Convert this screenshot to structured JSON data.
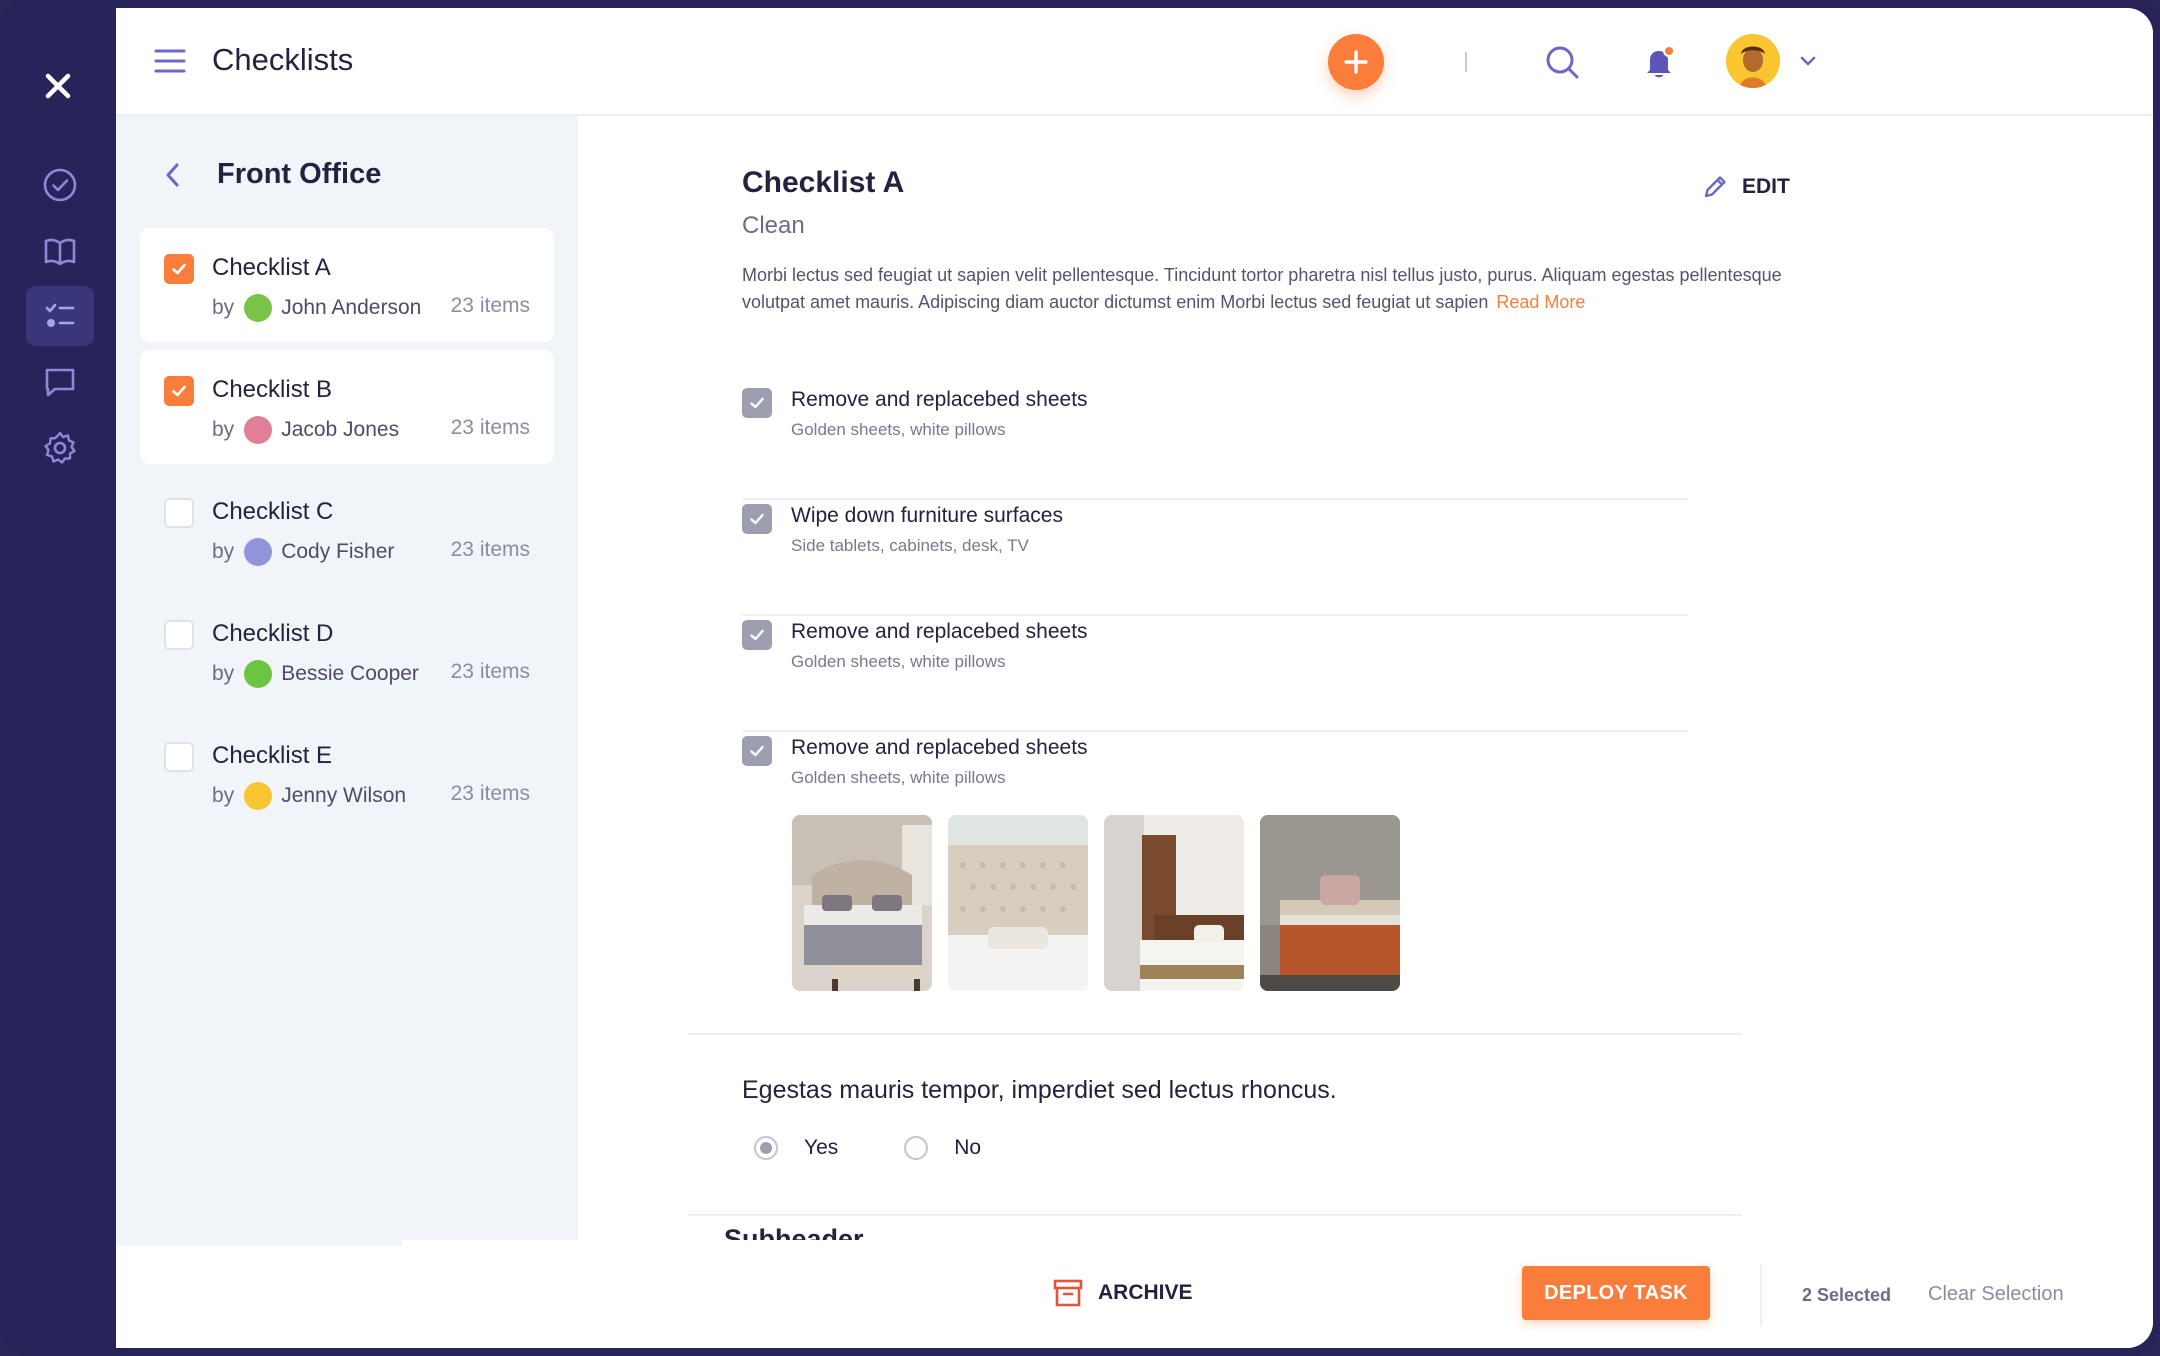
{
  "header": {
    "title": "Checklists"
  },
  "panel": {
    "title": "Front Office"
  },
  "checklists": [
    {
      "title": "Checklist A",
      "by": "by",
      "author": "John Anderson",
      "count": "23 items",
      "checked": true
    },
    {
      "title": "Checklist B",
      "by": "by",
      "author": "Jacob Jones",
      "count": "23 items",
      "checked": true
    },
    {
      "title": "Checklist C",
      "by": "by",
      "author": "Cody Fisher",
      "count": "23 items",
      "checked": false
    },
    {
      "title": "Checklist D",
      "by": "by",
      "author": "Bessie Cooper",
      "count": "23 items",
      "checked": false
    },
    {
      "title": "Checklist E",
      "by": "by",
      "author": "Jenny Wilson",
      "count": "23 items",
      "checked": false
    }
  ],
  "detail": {
    "title": "Checklist A",
    "subtitle": "Clean",
    "edit_label": "EDIT",
    "description": "Morbi lectus sed feugiat ut sapien velit pellentesque. Tincidunt tortor pharetra nisl tellus justo, purus. Aliquam egestas pellentesque volutpat amet mauris. Adipiscing diam auctor dictumst enim Morbi lectus sed feugiat ut sapien",
    "read_more": "Read More",
    "tasks": [
      {
        "name": "Remove and replacebed sheets",
        "note": "Golden sheets, white pillows"
      },
      {
        "name": "Wipe down furniture surfaces",
        "note": "Side tablets, cabinets, desk, TV"
      },
      {
        "name": "Remove and replacebed sheets",
        "note": "Golden sheets, white pillows"
      },
      {
        "name": "Remove and replacebed sheets",
        "note": "Golden sheets, white pillows"
      }
    ],
    "question": "Egestas mauris tempor, imperdiet sed lectus rhoncus.",
    "options": {
      "yes": "Yes",
      "no": "No",
      "selected": "Yes"
    },
    "subheader": "Subheader"
  },
  "actions": {
    "archive_label": "ARCHIVE",
    "deploy_label": "DEPLOY TASK",
    "selected_text": "2 Selected",
    "clear_label": "Clear Selection"
  },
  "colors": {
    "accent": "#fb7d3c",
    "rail": "#28245a",
    "panel": "#f1f4f9"
  }
}
